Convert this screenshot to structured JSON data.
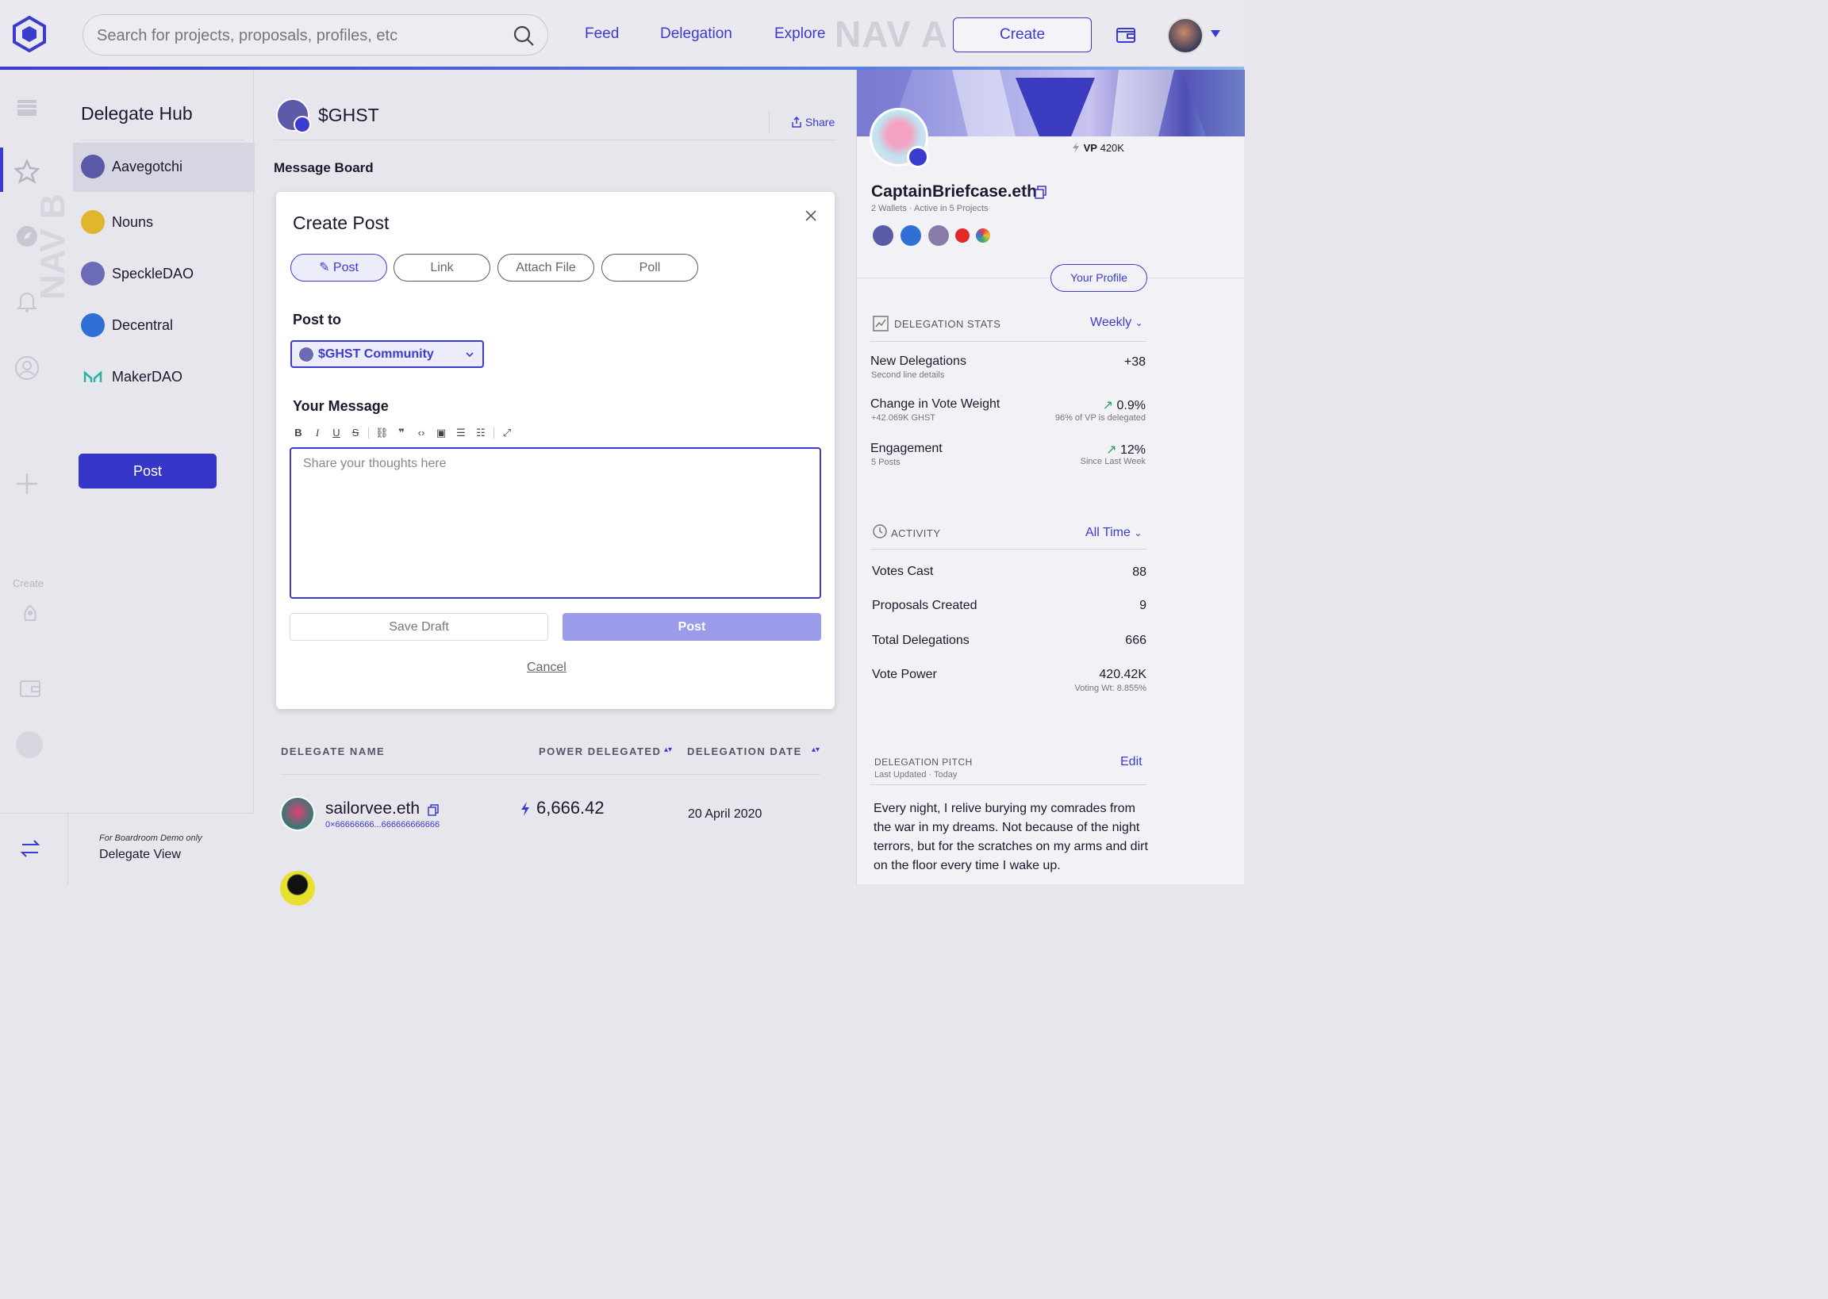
{
  "header": {
    "search_placeholder": "Search for projects, proposals, profiles, etc",
    "nav": [
      "Feed",
      "Delegation",
      "Explore"
    ],
    "nav_ghost": "NAV A",
    "create_label": "Create"
  },
  "rail": {
    "ghost": "NAV B",
    "create_label": "Create"
  },
  "hub": {
    "title": "Delegate Hub",
    "items": [
      {
        "label": "Aavegotchi",
        "color": "#5a5aa8"
      },
      {
        "label": "Nouns",
        "color": "#e0b62e"
      },
      {
        "label": "SpeckleDAO",
        "color": "#6b6bb8"
      },
      {
        "label": "Decentral",
        "color": "#2f6fd6"
      },
      {
        "label": "MakerDAO",
        "color": "#2ab3a3"
      }
    ],
    "post_label": "Post"
  },
  "footer": {
    "demo_note": "For Boardroom Demo only",
    "demo_view": "Delegate View"
  },
  "main": {
    "project_title": "$GHST",
    "share_label": "Share",
    "board_title": "Message Board",
    "table": {
      "col_name": "DELEGATE NAME",
      "col_power": "POWER DELEGATED",
      "col_date": "DELEGATION DATE",
      "rows": [
        {
          "name": "sailorvee.eth",
          "address": "0×66666666...666666666666",
          "power": "6,666.42",
          "date": "20 April 2020"
        }
      ]
    }
  },
  "modal": {
    "title": "Create Post",
    "tabs": [
      "Post",
      "Link",
      "Attach File",
      "Poll"
    ],
    "active_tab": "Post",
    "post_to_label": "Post to",
    "community": "$GHST Community",
    "message_label": "Your Message",
    "message_placeholder": "Share your thoughts here",
    "save_draft": "Save Draft",
    "post": "Post",
    "cancel": "Cancel"
  },
  "profile": {
    "vp_label": "VP",
    "vp_value": "420K",
    "name": "CaptainBriefcase.eth",
    "sub": "2 Wallets · Active in 5 Projects",
    "your_profile": "Your Profile",
    "stats": {
      "title": "DELEGATION STATS",
      "period": "Weekly",
      "rows": [
        {
          "label": "New Delegations",
          "sub": "Second line details",
          "value": "+38",
          "value_sub": ""
        },
        {
          "label": "Change in Vote Weight",
          "sub": "+42.069K GHST",
          "value": "0.9%",
          "value_sub": "96% of VP is delegated"
        },
        {
          "label": "Engagement",
          "sub": "5 Posts",
          "value": "12%",
          "value_sub": "Since Last Week"
        }
      ]
    },
    "activity": {
      "title": "ACTIVITY",
      "period": "All Time",
      "rows": [
        {
          "label": "Votes Cast",
          "value": "88"
        },
        {
          "label": "Proposals Created",
          "value": "9"
        },
        {
          "label": "Total Delegations",
          "value": "666"
        },
        {
          "label": "Vote Power",
          "value": "420.42K",
          "value_sub": "Voting Wt: 8.855%"
        }
      ]
    },
    "pitch": {
      "title": "DELEGATION PITCH",
      "sub": "Last Updated · Today",
      "edit": "Edit",
      "text": "Every night, I relive burying my comrades from the war in my dreams. Not because of the night terrors, but for the scratches on my arms and dirt on the floor every time I wake up."
    }
  }
}
